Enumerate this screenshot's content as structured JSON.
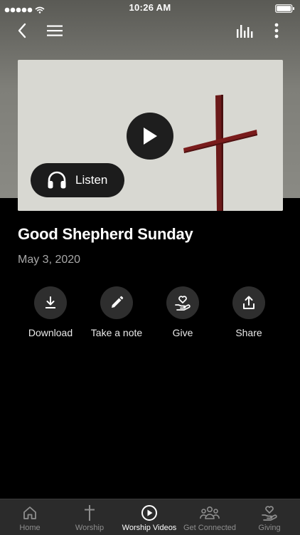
{
  "status_bar": {
    "time": "10:26 AM"
  },
  "nav": {
    "back_icon": "chevron-left-icon",
    "menu_icon": "hamburger-icon",
    "chart_icon": "bar-chart-icon",
    "more_icon": "more-vertical-icon"
  },
  "media": {
    "play_icon": "play-icon",
    "listen_label": "Listen"
  },
  "sermon": {
    "title": "Good Shepherd Sunday",
    "date": "May 3, 2020"
  },
  "actions": [
    {
      "label": "Download",
      "icon": "download-icon"
    },
    {
      "label": "Take a note",
      "icon": "pencil-icon"
    },
    {
      "label": "Give",
      "icon": "give-heart-hand-icon"
    },
    {
      "label": "Share",
      "icon": "share-icon"
    }
  ],
  "tabs": [
    {
      "label": "Home",
      "icon": "home-icon",
      "active": false
    },
    {
      "label": "Worship",
      "icon": "cross-icon",
      "active": false
    },
    {
      "label": "Worship Videos",
      "icon": "play-circle-icon",
      "active": true
    },
    {
      "label": "Get Connected",
      "icon": "people-icon",
      "active": false
    },
    {
      "label": "Giving",
      "icon": "give-heart-hand-icon",
      "active": false
    }
  ],
  "colors": {
    "background": "#000000",
    "header_gray": "#7f7f79",
    "button_dark": "#1e1e1e",
    "tab_bar": "#2b2b2b",
    "cross_red": "#7a1c1c"
  }
}
